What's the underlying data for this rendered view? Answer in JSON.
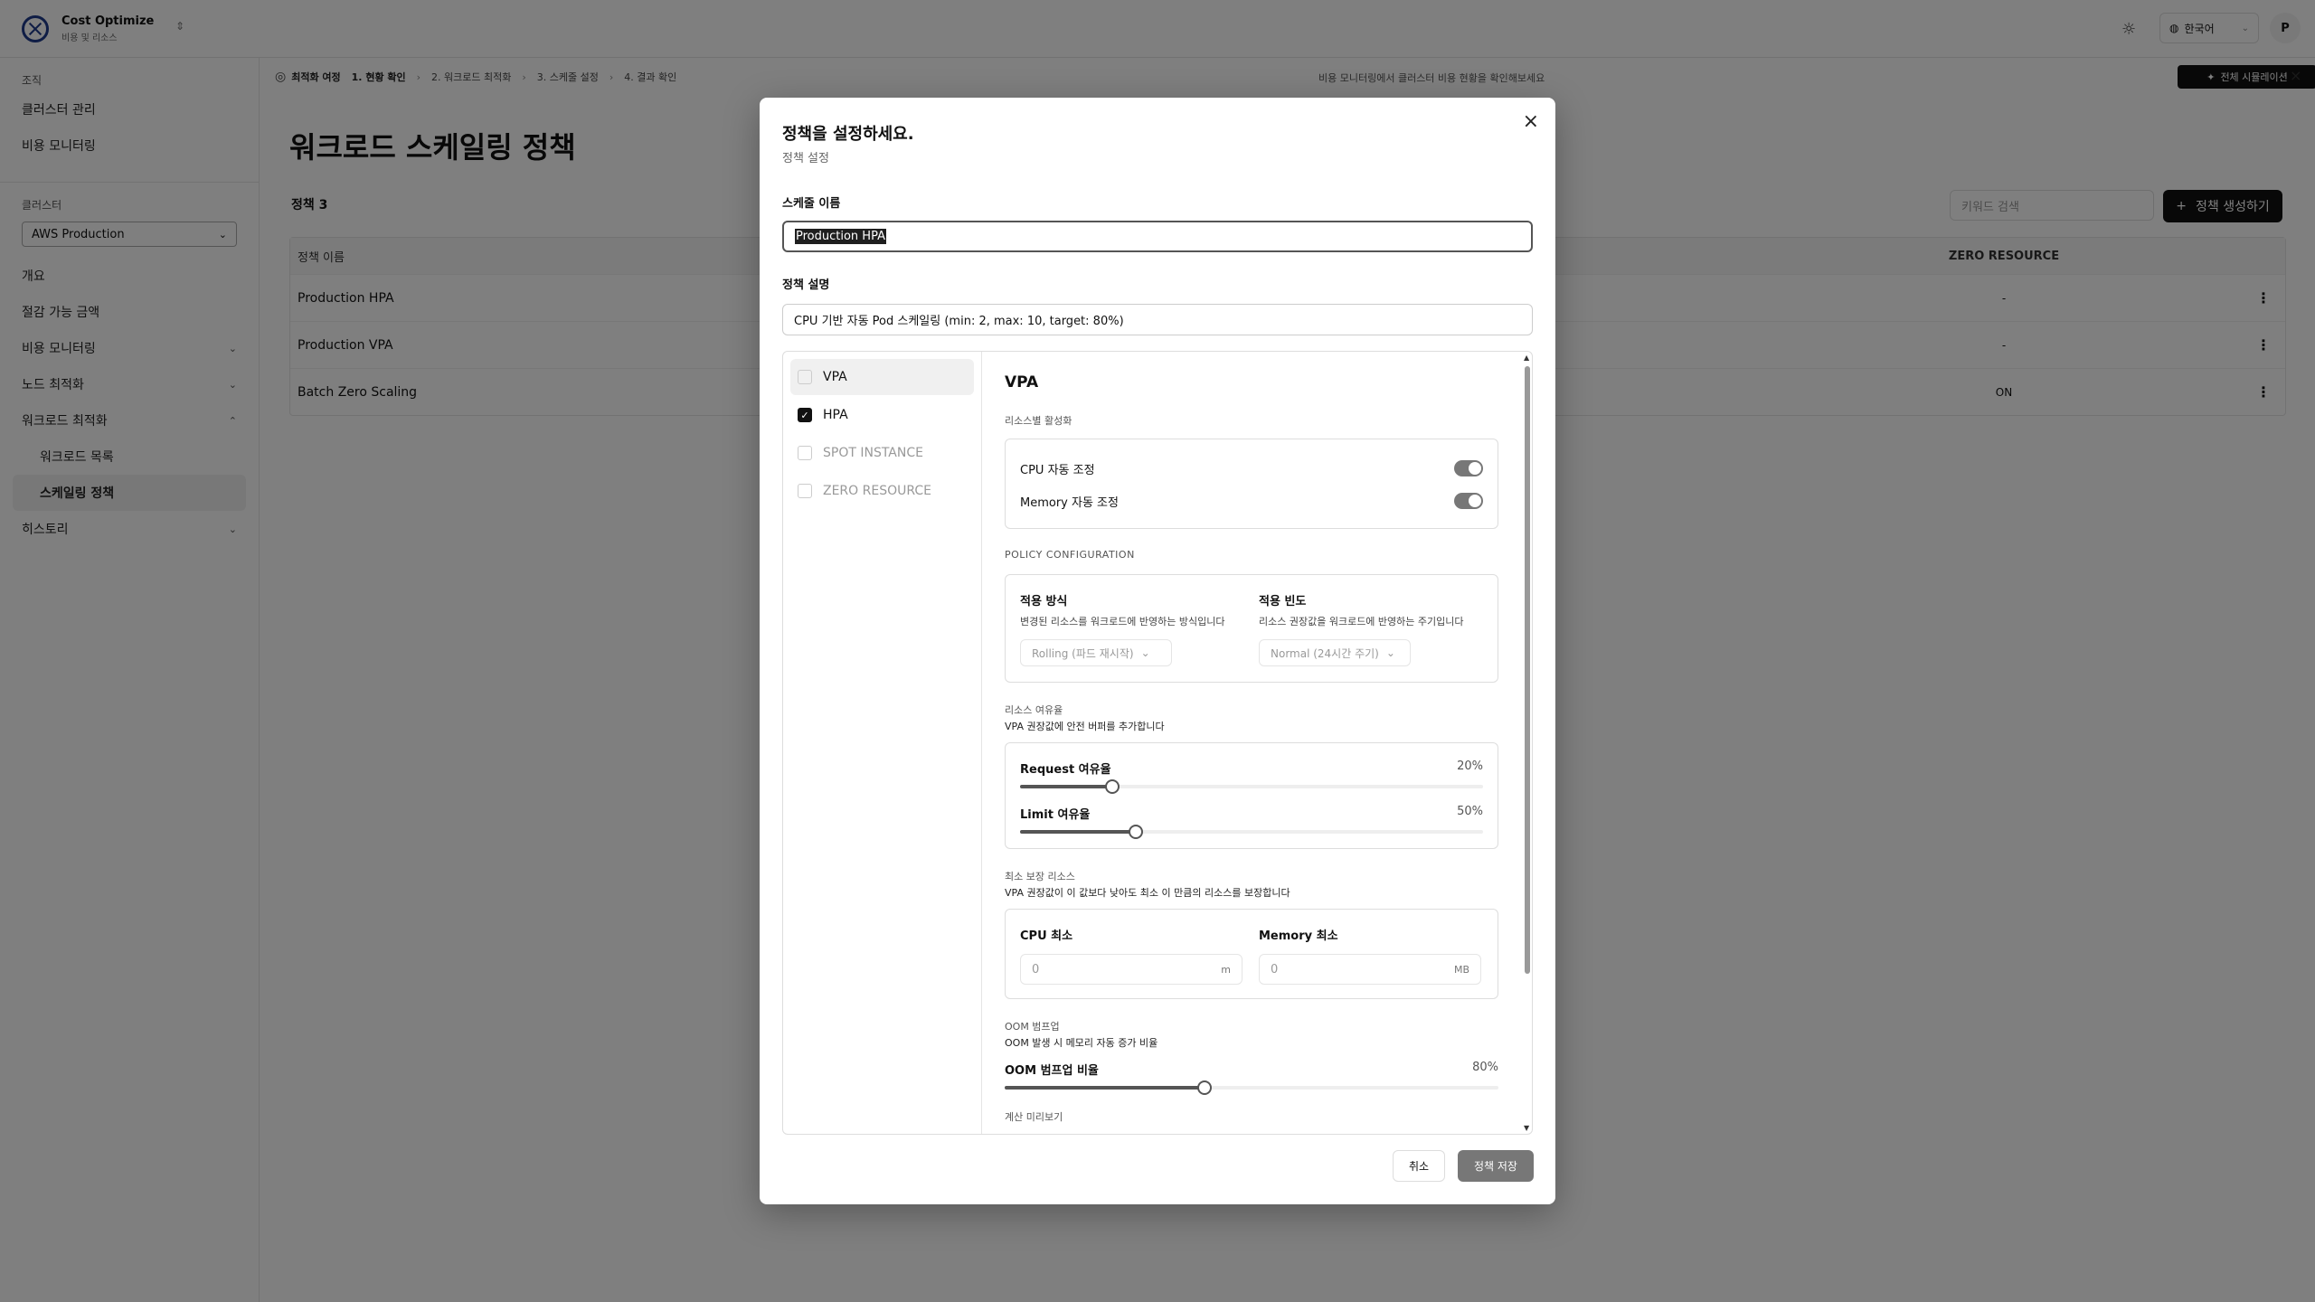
{
  "brand": {
    "name": "Cost Optimize",
    "subtitle": "비용 및 리소스"
  },
  "header": {
    "language": "한국어",
    "avatar_initial": "P"
  },
  "sidebar": {
    "org_section": "조직",
    "org_items": [
      "클러스터 관리",
      "비용 모니터링"
    ],
    "cluster_section": "클러스터",
    "cluster_value": "AWS Production",
    "nav": [
      {
        "label": "개요",
        "chevron": ""
      },
      {
        "label": "절감 가능 금액",
        "chevron": ""
      },
      {
        "label": "비용 모니터링",
        "chevron": "⌄"
      },
      {
        "label": "노드 최적화",
        "chevron": "⌄"
      },
      {
        "label": "워크로드 최적화",
        "chevron": "⌃"
      }
    ],
    "sub_items": [
      "워크로드 목록",
      "스케일링 정책"
    ],
    "history": {
      "label": "히스토리",
      "chevron": "⌄"
    }
  },
  "breadcrumb": {
    "journey": "최적화 여정",
    "steps": [
      "1. 현황 확인",
      "2. 워크로드 최적화",
      "3. 스케줄 설정",
      "4. 결과 확인"
    ],
    "hint": "비용 모니터링에서 클러스터 비용 현황을 확인해보세요",
    "sim_button": "전체 시뮬레이션"
  },
  "main": {
    "title": "워크로드 스케일링 정책",
    "policy_count": "정책 3",
    "search_placeholder": "키워드 검색",
    "create_button": "정책 생성하기",
    "table": {
      "col_name": "정책 이름",
      "col_zero": "ZERO RESOURCE",
      "rows": [
        {
          "name": "Production HPA",
          "zero": "-"
        },
        {
          "name": "Production VPA",
          "zero": "-"
        },
        {
          "name": "Batch Zero Scaling",
          "zero": "ON"
        }
      ]
    }
  },
  "modal": {
    "title": "정책을 설정하세요.",
    "subtitle": "정책 설정",
    "schedule_name_label": "스케줄 이름",
    "schedule_name_value": "Production HPA",
    "desc_label": "정책 설명",
    "desc_value": "CPU 기반 자동 Pod 스케일링 (min: 2, max: 10, target: 80%)",
    "policies": [
      {
        "label": "VPA",
        "checked": false
      },
      {
        "label": "HPA",
        "checked": true
      },
      {
        "label": "SPOT INSTANCE",
        "checked": false
      },
      {
        "label": "ZERO RESOURCE",
        "checked": false
      }
    ],
    "vpa": {
      "title": "VPA",
      "resource_caption": "리소스별 활성화",
      "cpu_toggle": "CPU 자동 조정",
      "memory_toggle": "Memory 자동 조정",
      "config_caption": "POLICY CONFIGURATION",
      "apply_method": {
        "title": "적용 방식",
        "desc": "변경된 리소스를 워크로드에 반영하는 방식입니다",
        "value": "Rolling (파드 재시작)"
      },
      "apply_freq": {
        "title": "적용 빈도",
        "desc": "리소스 권장값을 워크로드에 반영하는 주기입니다",
        "value": "Normal (24시간 주기)"
      },
      "margin_caption": "리소스 여유율",
      "margin_desc": "VPA 권장값에 안전 버퍼를 추가합니다",
      "request_margin": {
        "label": "Request 여유율",
        "value": "20%",
        "fraction": 0.2
      },
      "limit_margin": {
        "label": "Limit 여유율",
        "value": "50%",
        "fraction": 0.25
      },
      "min_caption": "최소 보장 리소스",
      "min_desc": "VPA 권장값이 이 값보다 낮아도 최소 이 만큼의 리소스를 보장합니다",
      "cpu_min": {
        "label": "CPU 최소",
        "placeholder": "0",
        "unit": "m"
      },
      "memory_min": {
        "label": "Memory 최소",
        "placeholder": "0",
        "unit": "MB"
      },
      "oom_caption": "OOM 범프업",
      "oom_desc": "OOM 발생 시 메모리 자동 증가 비율",
      "oom_ratio": {
        "label": "OOM 범프업 비율",
        "value": "80%",
        "fraction": 0.405
      },
      "preview_caption": "계산 미리보기"
    },
    "cancel": "취소",
    "save": "정책 저장"
  }
}
